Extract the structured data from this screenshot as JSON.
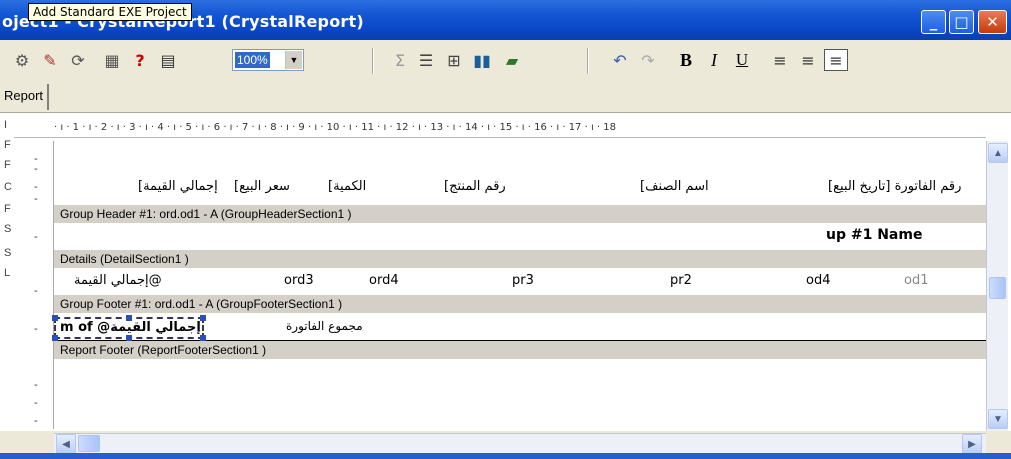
{
  "window": {
    "title": "oject1 - CrystalReport1 (CrystalReport)",
    "tooltip": "Add Standard EXE Project",
    "min_glyph": "_",
    "max_glyph": "□",
    "close_glyph": "✕"
  },
  "toolbar": {
    "zoom_value": "100%",
    "bold_label": "B",
    "italic_label": "I",
    "underline_label": "U",
    "sum_label": "Σ",
    "help_label": "?"
  },
  "tab": {
    "label": "Report"
  },
  "left_gutter_letters": [
    "I",
    "F",
    "F",
    "C",
    "F",
    "S",
    "S",
    "L"
  ],
  "ruler": {
    "marks": [
      "1",
      "2",
      "3",
      "4",
      "5",
      "6",
      "7",
      "8",
      "9",
      "10",
      "11",
      "12",
      "13",
      "14",
      "15",
      "16",
      "17",
      "18"
    ]
  },
  "page_header": {
    "fields": [
      "[إجمالي القيمة",
      "[سعر البيع",
      "[الكمية",
      "[رقم المنتج",
      "[اسم الصنف",
      "[رقم الفاتورة [تاريخ البيع"
    ]
  },
  "sections": {
    "group_header": "Group Header #1: ord.od1 - A (GroupHeaderSection1 )",
    "details": "Details (DetailSection1 )",
    "group_footer": "Group Footer #1: ord.od1 - A (GroupFooterSection1 )",
    "report_footer": "Report Footer (ReportFooterSection1 )"
  },
  "group_header_field": "up #1 Name",
  "details_fields": {
    "total": "إجمالي القيمة@",
    "ord3": "ord3",
    "ord4": "ord4",
    "pr3": "pr3",
    "pr2": "pr2",
    "od4": "od4",
    "od1": "od1"
  },
  "group_footer_fields": {
    "sum": "m of @إجمالي القيمة",
    "label": "مجموع الفاتورة"
  },
  "colors": {
    "title_bar": "#0a48c8",
    "section_band": "#d4d0c8",
    "selection_blue": "#316ac5"
  }
}
